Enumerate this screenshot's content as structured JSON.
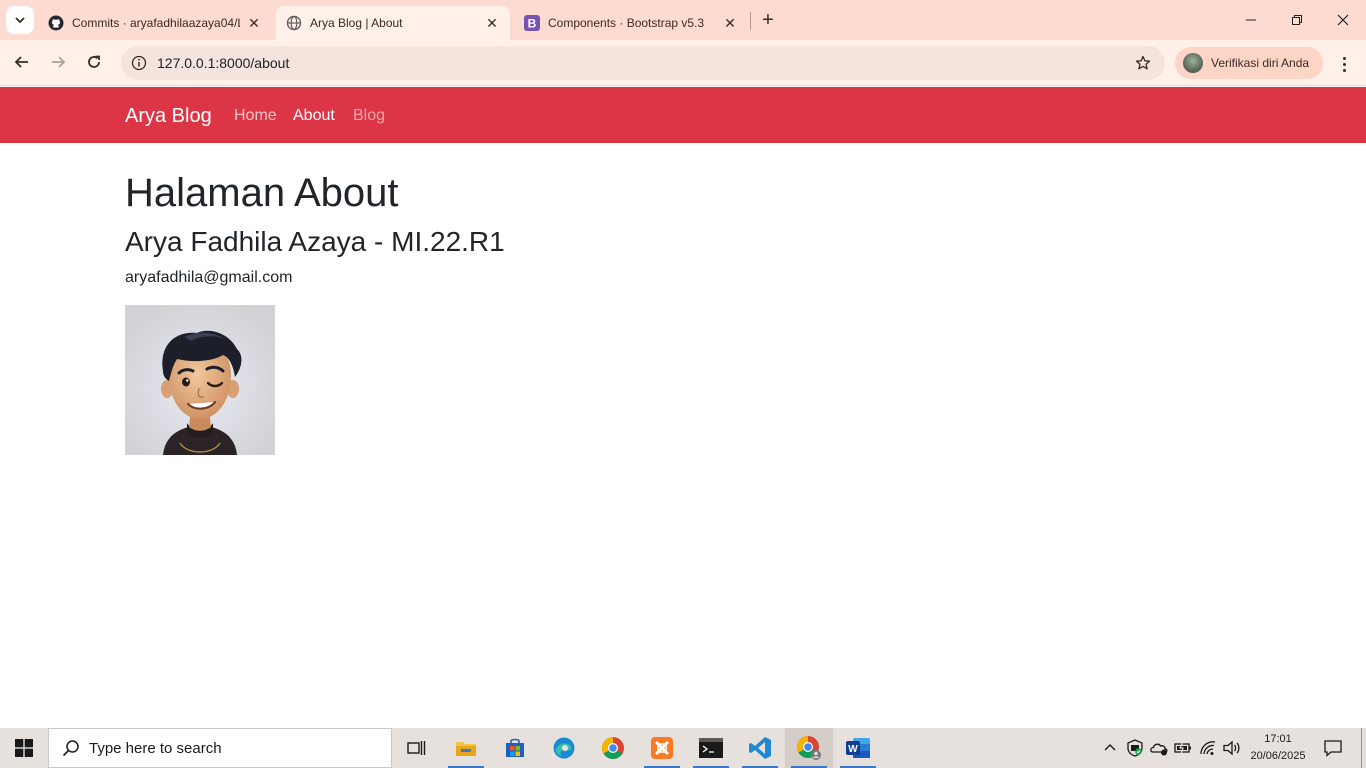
{
  "browser": {
    "tabs": [
      {
        "title": "Commits · aryafadhilaazaya04/L",
        "icon": "github-icon",
        "active": false
      },
      {
        "title": "Arya Blog | About",
        "icon": "globe-icon",
        "active": true
      },
      {
        "title": "Components · Bootstrap v5.3",
        "icon": "bootstrap-icon",
        "active": false
      }
    ],
    "url": "127.0.0.1:8000/about",
    "profile_label": "Verifikasi diri Anda",
    "theme_colors": {
      "tabstrip": "#fedbd0",
      "toolbar": "#fff0ea"
    }
  },
  "site": {
    "brand": "Arya Blog",
    "nav": [
      {
        "label": "Home",
        "active": false
      },
      {
        "label": "About",
        "active": true
      },
      {
        "label": "Blog",
        "active": false
      }
    ],
    "navbar_color": "#dc3545"
  },
  "about": {
    "heading": "Halaman About",
    "name_line": "Arya Fadhila Azaya - MI.22.R1",
    "email": "aryafadhila@gmail.com",
    "photo_icon": "avatar-photo"
  },
  "taskbar": {
    "search_placeholder": "Type here to search",
    "apps": [
      "task-view-icon",
      "file-explorer-icon",
      "microsoft-store-icon",
      "edge-icon",
      "chrome-icon",
      "xampp-icon",
      "terminal-icon",
      "vscode-icon",
      "chrome-icon",
      "word-icon"
    ],
    "tray_icons": [
      "chevron-up-icon",
      "shield-icon",
      "onedrive-icon",
      "battery-icon",
      "wifi-icon",
      "volume-icon"
    ],
    "time": "17:01",
    "date": "20/06/2025"
  }
}
